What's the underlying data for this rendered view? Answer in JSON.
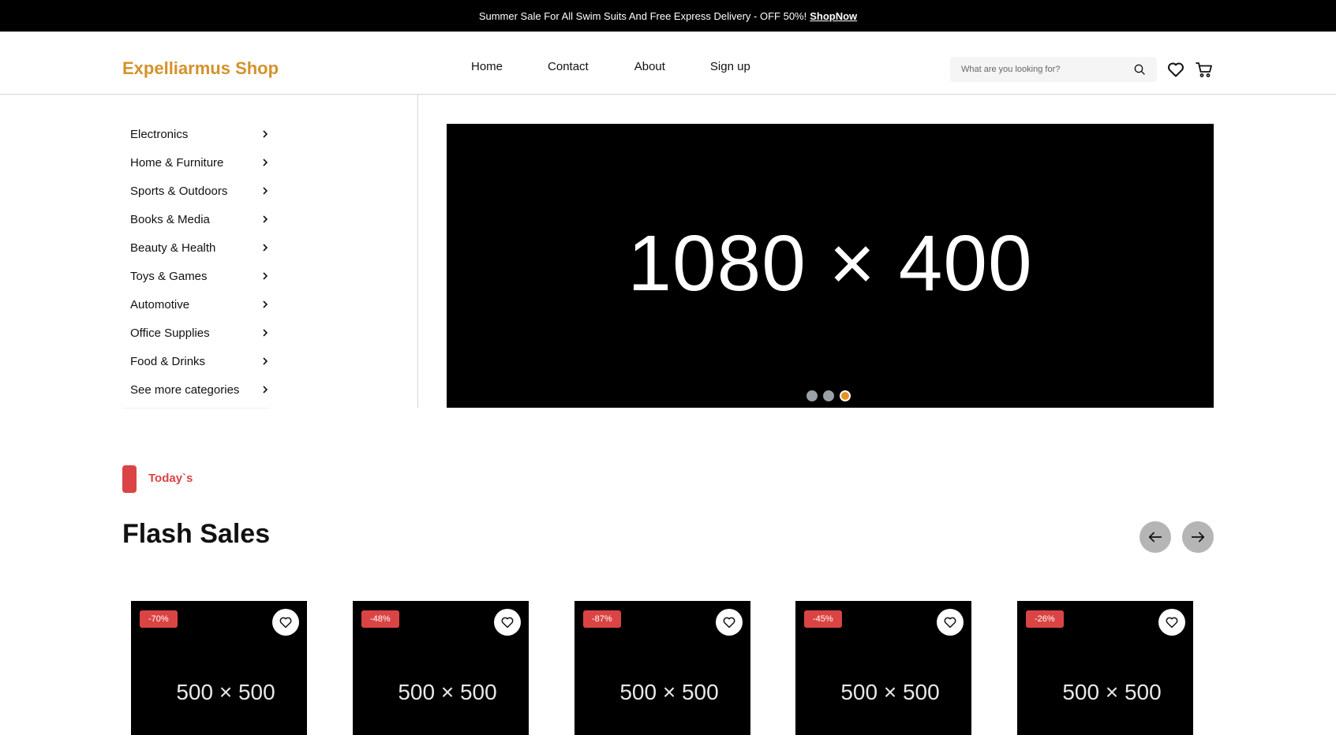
{
  "topbar": {
    "message": "Summer Sale For All Swim Suits And Free Express Delivery - OFF 50%!",
    "link": "ShopNow"
  },
  "header": {
    "logo": "Expelliarmus Shop",
    "nav": [
      "Home",
      "Contact",
      "About",
      "Sign up"
    ],
    "search_placeholder": "What are you looking for?"
  },
  "sidebar": {
    "categories": [
      "Electronics",
      "Home & Furniture",
      "Sports & Outdoors",
      "Books & Media",
      "Beauty & Health",
      "Toys & Games",
      "Automotive",
      "Office Supplies",
      "Food & Drinks",
      "See more categories"
    ]
  },
  "hero": {
    "placeholder": "1080 × 400",
    "slides": 3,
    "active_slide": 3
  },
  "flash": {
    "eyebrow": "Today`s",
    "title": "Flash Sales",
    "products": [
      {
        "discount": "-70%",
        "placeholder": "500 × 500"
      },
      {
        "discount": "-48%",
        "placeholder": "500 × 500"
      },
      {
        "discount": "-87%",
        "placeholder": "500 × 500"
      },
      {
        "discount": "-45%",
        "placeholder": "500 × 500"
      },
      {
        "discount": "-26%",
        "placeholder": "500 × 500"
      }
    ]
  },
  "colors": {
    "accent": "#db4444",
    "brand": "#d4922a",
    "slide_active": "#e89321"
  },
  "icons": {
    "search": "search-icon",
    "wishlist": "heart-icon",
    "cart": "cart-icon",
    "category": "chevron-right-icon",
    "prev": "arrow-left-icon",
    "next": "arrow-right-icon"
  }
}
